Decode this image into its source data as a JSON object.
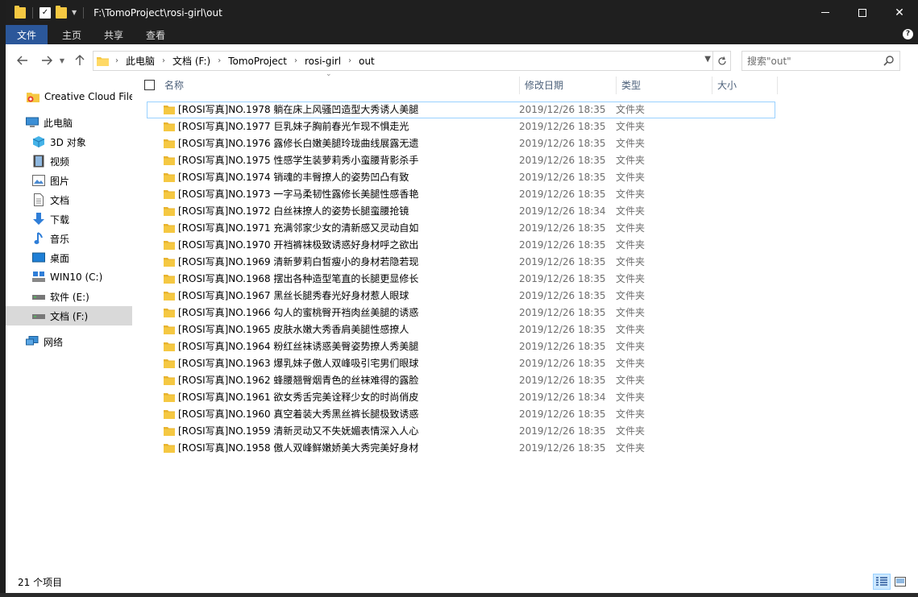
{
  "window": {
    "title": "F:\\TomoProject\\rosi-girl\\out"
  },
  "ribbon": {
    "tabs": [
      "文件",
      "主页",
      "共享",
      "查看"
    ]
  },
  "address": {
    "crumbs": [
      "此电脑",
      "文档 (F:)",
      "TomoProject",
      "rosi-girl",
      "out"
    ]
  },
  "search": {
    "placeholder": "搜索\"out\""
  },
  "sidebar": {
    "items": [
      {
        "label": "Creative Cloud Files",
        "icon": "creative-cloud-icon"
      },
      {
        "label": "此电脑",
        "icon": "computer-icon"
      },
      {
        "label": "3D 对象",
        "icon": "3d-objects-icon"
      },
      {
        "label": "视频",
        "icon": "video-icon"
      },
      {
        "label": "图片",
        "icon": "pictures-icon"
      },
      {
        "label": "文档",
        "icon": "documents-icon"
      },
      {
        "label": "下载",
        "icon": "download-icon"
      },
      {
        "label": "音乐",
        "icon": "music-icon"
      },
      {
        "label": "桌面",
        "icon": "desktop-icon"
      },
      {
        "label": "WIN10 (C:)",
        "icon": "system-drive-icon"
      },
      {
        "label": "软件 (E:)",
        "icon": "drive-icon"
      },
      {
        "label": "文档 (F:)",
        "icon": "drive-icon"
      },
      {
        "label": "网络",
        "icon": "network-icon"
      }
    ]
  },
  "columns": {
    "name": "名称",
    "modified": "修改日期",
    "type": "类型",
    "size": "大小"
  },
  "files": [
    {
      "name": "[ROSI写真]NO.1978 躺在床上风骚凹造型大秀诱人美腿",
      "modified": "2019/12/26 18:35",
      "type": "文件夹"
    },
    {
      "name": "[ROSI写真]NO.1977 巨乳妹子胸前春光乍现不惧走光",
      "modified": "2019/12/26 18:35",
      "type": "文件夹"
    },
    {
      "name": "[ROSI写真]NO.1976 露修长白嫩美腿玲珑曲线展露无遗",
      "modified": "2019/12/26 18:35",
      "type": "文件夹"
    },
    {
      "name": "[ROSI写真]NO.1975 性感学生装萝莉秀小蛮腰背影杀手",
      "modified": "2019/12/26 18:35",
      "type": "文件夹"
    },
    {
      "name": "[ROSI写真]NO.1974 销魂的丰臀撩人的姿势凹凸有致",
      "modified": "2019/12/26 18:35",
      "type": "文件夹"
    },
    {
      "name": "[ROSI写真]NO.1973 一字马柔韧性露修长美腿性感香艳",
      "modified": "2019/12/26 18:35",
      "type": "文件夹"
    },
    {
      "name": "[ROSI写真]NO.1972 白丝袜撩人的姿势长腿蛮腰抢镜",
      "modified": "2019/12/26 18:34",
      "type": "文件夹"
    },
    {
      "name": "[ROSI写真]NO.1971 充满邻家少女的清新感又灵动自如",
      "modified": "2019/12/26 18:35",
      "type": "文件夹"
    },
    {
      "name": "[ROSI写真]NO.1970 开裆裤袜极致诱惑好身材呼之欲出",
      "modified": "2019/12/26 18:35",
      "type": "文件夹"
    },
    {
      "name": "[ROSI写真]NO.1969 清新萝莉白皙瘦小的身材若隐若现",
      "modified": "2019/12/26 18:35",
      "type": "文件夹"
    },
    {
      "name": "[ROSI写真]NO.1968 摆出各种造型笔直的长腿更显修长",
      "modified": "2019/12/26 18:35",
      "type": "文件夹"
    },
    {
      "name": "[ROSI写真]NO.1967 黑丝长腿秀春光好身材惹人眼球",
      "modified": "2019/12/26 18:35",
      "type": "文件夹"
    },
    {
      "name": "[ROSI写真]NO.1966 勾人的蜜桃臀开裆肉丝美腿的诱惑",
      "modified": "2019/12/26 18:35",
      "type": "文件夹"
    },
    {
      "name": "[ROSI写真]NO.1965 皮肤水嫩大秀香肩美腿性感撩人",
      "modified": "2019/12/26 18:35",
      "type": "文件夹"
    },
    {
      "name": "[ROSI写真]NO.1964 粉红丝袜诱惑美臀姿势撩人秀美腿",
      "modified": "2019/12/26 18:35",
      "type": "文件夹"
    },
    {
      "name": "[ROSI写真]NO.1963 爆乳妹子傲人双峰吸引宅男们眼球",
      "modified": "2019/12/26 18:35",
      "type": "文件夹"
    },
    {
      "name": "[ROSI写真]NO.1962 蜂腰翘臀烟青色的丝袜难得的露脸",
      "modified": "2019/12/26 18:35",
      "type": "文件夹"
    },
    {
      "name": "[ROSI写真]NO.1961 欲女秀舌完美诠释少女的时尚俏皮",
      "modified": "2019/12/26 18:34",
      "type": "文件夹"
    },
    {
      "name": "[ROSI写真]NO.1960 真空着装大秀黑丝裤长腿极致诱惑",
      "modified": "2019/12/26 18:35",
      "type": "文件夹"
    },
    {
      "name": "[ROSI写真]NO.1959 清新灵动又不失妩媚表情深入人心",
      "modified": "2019/12/26 18:35",
      "type": "文件夹"
    },
    {
      "name": "[ROSI写真]NO.1958 傲人双峰鲜嫩娇美大秀完美好身材",
      "modified": "2019/12/26 18:35",
      "type": "文件夹"
    }
  ],
  "status": {
    "count": "21 个项目"
  },
  "colors": {
    "accent": "#2b579a",
    "folder": "#f5c842",
    "selection": "#cce8ff",
    "header_text": "#4c607a"
  }
}
